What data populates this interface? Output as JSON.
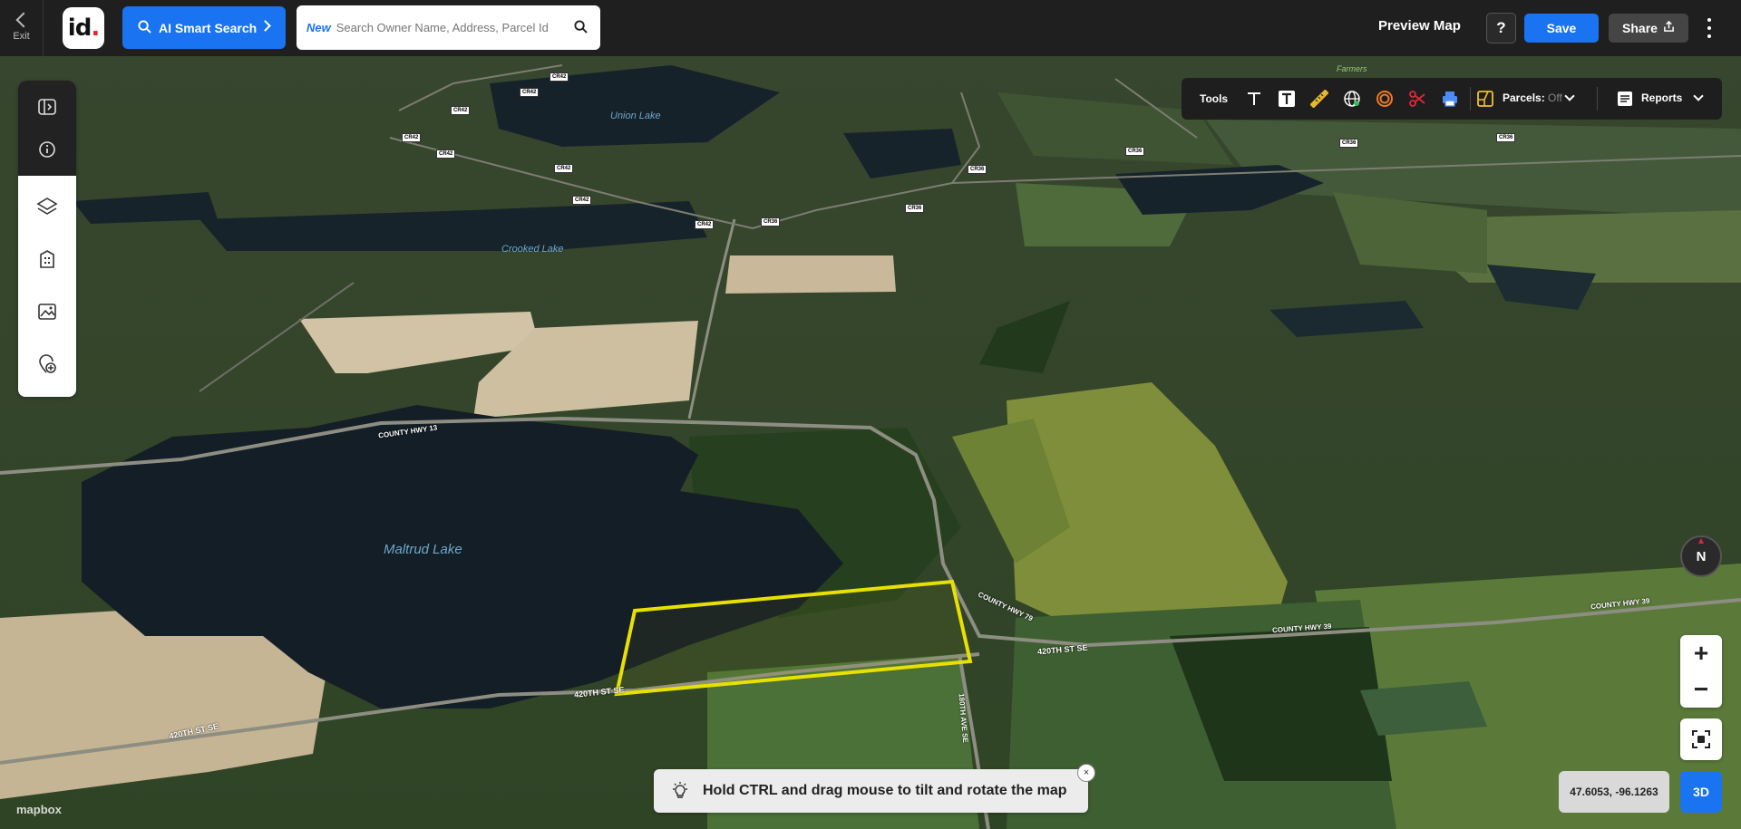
{
  "header": {
    "exit_label": "Exit",
    "logo_text": "id",
    "ai_search_label": "AI Smart Search",
    "search_new_tag": "New",
    "search_placeholder": "Search Owner Name, Address, Parcel Id",
    "preview_map_label": "Preview Map",
    "help_label": "?",
    "save_label": "Save",
    "share_label": "Share"
  },
  "left_toolbar": {
    "items": [
      "sidebar-toggle-icon",
      "info-icon",
      "layers-icon",
      "building-icon",
      "image-icon",
      "add-location-icon"
    ]
  },
  "tools_bar": {
    "tools_label": "Tools",
    "parcels_label": "Parcels:",
    "parcels_state": "Off",
    "reports_label": "Reports",
    "icons": [
      "text-icon",
      "text-box-icon",
      "ruler-icon",
      "globe-icon",
      "radius-icon",
      "scissors-icon",
      "print-icon",
      "parcel-icon"
    ]
  },
  "map": {
    "labels": {
      "union_lake": "Union Lake",
      "crooked_lake": "Crooked Lake",
      "maltrud_lake": "Maltrud Lake",
      "road_420th_a": "420TH ST SE",
      "road_420th_b": "420TH ST SE",
      "road_420th_c": "420TH ST SE",
      "county_hwy_39_a": "COUNTY HWY 39",
      "county_hwy_39_b": "COUNTY HWY 39",
      "county_hwy_79": "COUNTY HWY 79",
      "county_hwy_13": "COUNTY HWY 13",
      "ave_180th": "180TH AVE SE",
      "farmers": "Farmers"
    },
    "shields": [
      "CR42",
      "CR42",
      "CR42",
      "CR42",
      "CR42",
      "CR42",
      "CR42",
      "CR42",
      "CR36",
      "CR36",
      "CR36",
      "CR36",
      "CR36",
      "CR36"
    ],
    "highlight_color": "#e8e000",
    "attribution": "mapbox"
  },
  "controls": {
    "compass_label": "N",
    "zoom_in": "+",
    "zoom_out": "−",
    "coordinates": "47.6053, -96.1263",
    "mode_3d_label": "3D"
  },
  "tip": {
    "text": "Hold CTRL and drag mouse to tilt and rotate the map",
    "close_label": "×"
  }
}
